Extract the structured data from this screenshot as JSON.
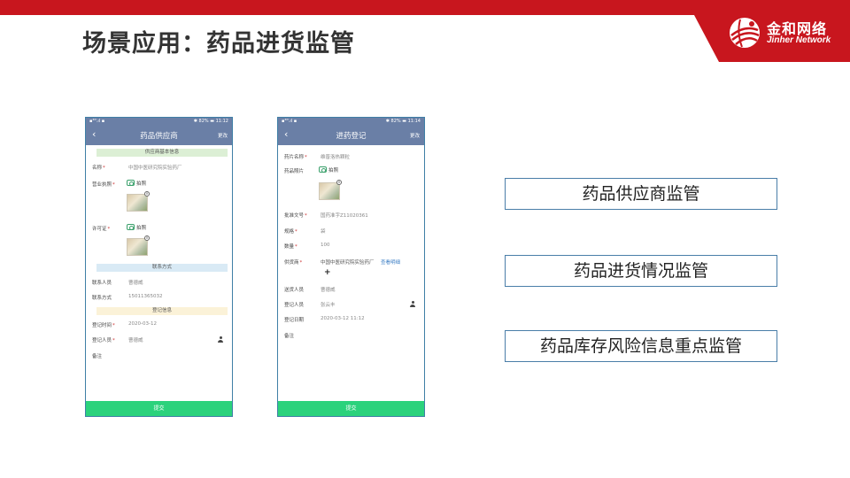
{
  "slide": {
    "title": "场景应用：药品进货监管",
    "logo": {
      "cn": "金和网络",
      "en": "Jinher Network"
    }
  },
  "features": [
    "药品供应商监管",
    "药品进货情况监管",
    "药品库存风险信息重点监管"
  ],
  "phone1": {
    "status_left": "▪⁴ᴳ.ıl ▪",
    "status_right": "✱ 82% ▬ 11:12",
    "nav": {
      "back": "‹",
      "title": "药品供应商",
      "action": "更改"
    },
    "sections": {
      "basic": "供应商基本信息",
      "contact": "联系方式",
      "register": "登记信息"
    },
    "fields": {
      "name_label": "名称",
      "name_value": "中国中医研究院实验药厂",
      "license_label": "营业执照",
      "license_photo": "拍照",
      "permit_label": "许可证",
      "permit_photo": "拍照",
      "contact_person_label": "联系人员",
      "contact_person_value": "曹德威",
      "contact_phone_label": "联系方式",
      "contact_phone_value": "15011365032",
      "reg_time_label": "登记时间",
      "reg_time_value": "2020-03-12",
      "reg_person_label": "登记人员",
      "reg_person_value": "曹德威",
      "remark_label": "备注"
    },
    "submit": "提交"
  },
  "phone2": {
    "status_left": "▪⁴ᴳ.ıl ▪",
    "status_right": "✱ 82% ▬ 11:14",
    "nav": {
      "back": "‹",
      "title": "进药登记",
      "action": "更改"
    },
    "fields": {
      "drug_name_label": "药片名称",
      "drug_name_value": "维普洛热颗粒",
      "drug_photo_label": "药品照片",
      "drug_photo": "拍照",
      "approval_label": "批准文号",
      "approval_value": "国药准字Z11020361",
      "spec_label": "规格",
      "spec_value": "袋",
      "qty_label": "数量",
      "qty_value": "100",
      "supplier_label": "供货商",
      "supplier_value": "中国中医研究院实验药厂",
      "supplier_link": "查看明细",
      "delivery_label": "送货人员",
      "delivery_value": "曹德威",
      "reg_person_label": "登记人员",
      "reg_person_value": "张云丰",
      "reg_date_label": "登记日期",
      "reg_date_value": "2020-03-12 11:12",
      "remark_label": "备注"
    },
    "submit": "提交"
  }
}
